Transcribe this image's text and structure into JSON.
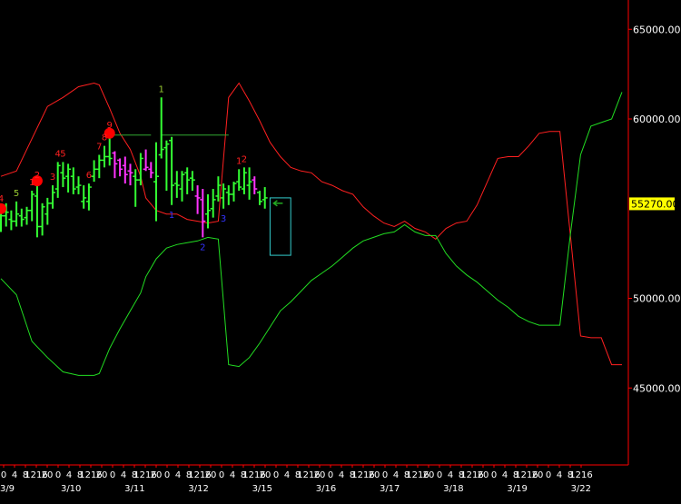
{
  "chart_data": {
    "type": "ohlc",
    "title": "",
    "xlabel": "",
    "ylabel": "",
    "ylim": [
      40000,
      68000
    ],
    "colors": {
      "background": "#000000",
      "axis": "#ff0000",
      "up_bar": "#33ff33",
      "down_bar": "#ff33ff",
      "upper_band": "#ff2020",
      "lower_band": "#22dd22",
      "count_red": "#ff2020",
      "count_green": "#9acd32",
      "count_blue": "#3333ff",
      "marker": "#ff0000",
      "box": "#33cccc",
      "resistance": "#33aa33",
      "price_tag_bg": "#ffff00",
      "arrow": "#22aa22"
    },
    "y_ticks": [
      {
        "value": 65000,
        "label": "65000.00"
      },
      {
        "value": 60000,
        "label": "60000.00"
      },
      {
        "value": 50000,
        "label": "50000.00"
      },
      {
        "value": 45000,
        "label": "45000.00"
      }
    ],
    "current_price": {
      "value": 55270,
      "label": "55270.00"
    },
    "x_time_labels": [
      "0",
      "4",
      "8",
      "1216",
      "20",
      "0",
      "4",
      "8",
      "1216",
      "20",
      "0",
      "4",
      "8",
      "1216",
      "20",
      "0",
      "4",
      "8",
      "1216",
      "20",
      "0",
      "4",
      "8",
      "1216",
      "20",
      "0",
      "4",
      "8",
      "1216",
      "20",
      "0",
      "4",
      "8",
      "1216",
      "20",
      "0",
      "4",
      "8",
      "1216",
      "20",
      "0",
      "4",
      "8",
      "1216",
      "20",
      "0",
      "4",
      "8",
      "1216",
      "20",
      "0",
      "4",
      "8",
      "1216"
    ],
    "x_date_labels": [
      {
        "index": 0,
        "label": "3/9"
      },
      {
        "index": 12,
        "label": "3/10"
      },
      {
        "index": 24,
        "label": "3/11"
      },
      {
        "index": 36,
        "label": "3/12"
      },
      {
        "index": 48,
        "label": "3/15"
      },
      {
        "index": 60,
        "label": "3/16"
      },
      {
        "index": 72,
        "label": "3/17"
      },
      {
        "index": 84,
        "label": "3/18"
      },
      {
        "index": 96,
        "label": "3/19"
      },
      {
        "index": 108,
        "label": "3/22"
      }
    ],
    "bars": [
      {
        "t": 0,
        "o": 54200,
        "h": 55100,
        "l": 53700,
        "c": 54600,
        "color": "up"
      },
      {
        "t": 1,
        "o": 54600,
        "h": 55300,
        "l": 54000,
        "c": 54800,
        "color": "up"
      },
      {
        "t": 2,
        "o": 54400,
        "h": 54900,
        "l": 53800,
        "c": 54300,
        "color": "up"
      },
      {
        "t": 3,
        "o": 54300,
        "h": 55400,
        "l": 54000,
        "c": 54700,
        "color": "up"
      },
      {
        "t": 4,
        "o": 54600,
        "h": 55000,
        "l": 54000,
        "c": 54400,
        "color": "up"
      },
      {
        "t": 5,
        "o": 54500,
        "h": 55100,
        "l": 54100,
        "c": 54900,
        "color": "up"
      },
      {
        "t": 6,
        "o": 54900,
        "h": 56000,
        "l": 54300,
        "c": 55800,
        "color": "up"
      },
      {
        "t": 7,
        "o": 55700,
        "h": 56400,
        "l": 53400,
        "c": 54000,
        "color": "up"
      },
      {
        "t": 8,
        "o": 54000,
        "h": 55300,
        "l": 53500,
        "c": 55100,
        "color": "up"
      },
      {
        "t": 9,
        "o": 54700,
        "h": 55600,
        "l": 54100,
        "c": 55300,
        "color": "up"
      },
      {
        "t": 10,
        "o": 55300,
        "h": 56300,
        "l": 55000,
        "c": 55900,
        "color": "up"
      },
      {
        "t": 11,
        "o": 56100,
        "h": 57600,
        "l": 55600,
        "c": 57400,
        "color": "up"
      },
      {
        "t": 12,
        "o": 57000,
        "h": 57600,
        "l": 56200,
        "c": 56700,
        "color": "up"
      },
      {
        "t": 13,
        "o": 56800,
        "h": 57500,
        "l": 55900,
        "c": 57200,
        "color": "up"
      },
      {
        "t": 14,
        "o": 56800,
        "h": 57300,
        "l": 55800,
        "c": 56100,
        "color": "up"
      },
      {
        "t": 15,
        "o": 56200,
        "h": 56800,
        "l": 55800,
        "c": 56300,
        "color": "up"
      },
      {
        "t": 16,
        "o": 55400,
        "h": 56300,
        "l": 55000,
        "c": 55600,
        "color": "up"
      },
      {
        "t": 17,
        "o": 55400,
        "h": 56400,
        "l": 54900,
        "c": 56200,
        "color": "up"
      },
      {
        "t": 18,
        "o": 56800,
        "h": 57700,
        "l": 56500,
        "c": 57200,
        "color": "up"
      },
      {
        "t": 19,
        "o": 57200,
        "h": 58000,
        "l": 56700,
        "c": 57700,
        "color": "up"
      },
      {
        "t": 20,
        "o": 57700,
        "h": 58500,
        "l": 57300,
        "c": 57900,
        "color": "up"
      },
      {
        "t": 21,
        "o": 57900,
        "h": 59200,
        "l": 57400,
        "c": 57800,
        "color": "up"
      },
      {
        "t": 22,
        "o": 58100,
        "h": 58200,
        "l": 56700,
        "c": 57500,
        "color": "down"
      },
      {
        "t": 23,
        "o": 57700,
        "h": 57800,
        "l": 56800,
        "c": 57200,
        "color": "down"
      },
      {
        "t": 24,
        "o": 57400,
        "h": 57900,
        "l": 56400,
        "c": 56900,
        "color": "down"
      },
      {
        "t": 25,
        "o": 57100,
        "h": 57500,
        "l": 56300,
        "c": 57000,
        "color": "down"
      },
      {
        "t": 26,
        "o": 56800,
        "h": 57200,
        "l": 55100,
        "c": 56600,
        "color": "up"
      },
      {
        "t": 27,
        "o": 56600,
        "h": 58100,
        "l": 56300,
        "c": 57800,
        "color": "up"
      },
      {
        "t": 28,
        "o": 57200,
        "h": 58300,
        "l": 57100,
        "c": 57300,
        "color": "down"
      },
      {
        "t": 29,
        "o": 57200,
        "h": 57600,
        "l": 56700,
        "c": 57000,
        "color": "down"
      },
      {
        "t": 30,
        "o": 56500,
        "h": 58700,
        "l": 54300,
        "c": 56800,
        "color": "up"
      },
      {
        "t": 31,
        "o": 58000,
        "h": 61200,
        "l": 57800,
        "c": 58300,
        "color": "up"
      },
      {
        "t": 32,
        "o": 58400,
        "h": 58800,
        "l": 56000,
        "c": 58600,
        "color": "up"
      },
      {
        "t": 33,
        "o": 58800,
        "h": 59000,
        "l": 55200,
        "c": 56300,
        "color": "up"
      },
      {
        "t": 34,
        "o": 56400,
        "h": 57100,
        "l": 55600,
        "c": 56300,
        "color": "up"
      },
      {
        "t": 35,
        "o": 56100,
        "h": 57100,
        "l": 55400,
        "c": 56900,
        "color": "up"
      },
      {
        "t": 36,
        "o": 57000,
        "h": 57300,
        "l": 55800,
        "c": 56600,
        "color": "up"
      },
      {
        "t": 37,
        "o": 56700,
        "h": 57100,
        "l": 56000,
        "c": 56600,
        "color": "up"
      },
      {
        "t": 38,
        "o": 55700,
        "h": 56300,
        "l": 54700,
        "c": 55600,
        "color": "down"
      },
      {
        "t": 39,
        "o": 55500,
        "h": 56100,
        "l": 53400,
        "c": 54300,
        "color": "down"
      },
      {
        "t": 40,
        "o": 54700,
        "h": 55800,
        "l": 53900,
        "c": 54900,
        "color": "up"
      },
      {
        "t": 41,
        "o": 55000,
        "h": 56100,
        "l": 54500,
        "c": 55500,
        "color": "up"
      },
      {
        "t": 42,
        "o": 55700,
        "h": 56800,
        "l": 55400,
        "c": 56300,
        "color": "up"
      },
      {
        "t": 43,
        "o": 55600,
        "h": 56400,
        "l": 55000,
        "c": 56100,
        "color": "up"
      },
      {
        "t": 44,
        "o": 55900,
        "h": 56300,
        "l": 55200,
        "c": 55800,
        "color": "up"
      },
      {
        "t": 45,
        "o": 55800,
        "h": 56500,
        "l": 55400,
        "c": 56400,
        "color": "up"
      },
      {
        "t": 46,
        "o": 56500,
        "h": 57200,
        "l": 56000,
        "c": 56200,
        "color": "up"
      },
      {
        "t": 47,
        "o": 56100,
        "h": 57300,
        "l": 55800,
        "c": 57000,
        "color": "up"
      },
      {
        "t": 48,
        "o": 56300,
        "h": 57300,
        "l": 55500,
        "c": 56500,
        "color": "up"
      },
      {
        "t": 49,
        "o": 56600,
        "h": 56800,
        "l": 55800,
        "c": 56100,
        "color": "down"
      },
      {
        "t": 50,
        "o": 55900,
        "h": 56000,
        "l": 55200,
        "c": 55400,
        "color": "up"
      },
      {
        "t": 51,
        "o": 55500,
        "h": 56200,
        "l": 55000,
        "c": 55600,
        "color": "up"
      }
    ],
    "upper_band": [
      [
        0,
        56800
      ],
      [
        3,
        57100
      ],
      [
        6,
        58900
      ],
      [
        9,
        60700
      ],
      [
        12,
        61200
      ],
      [
        15,
        61800
      ],
      [
        18,
        62000
      ],
      [
        19,
        61900
      ],
      [
        21,
        60600
      ],
      [
        23,
        59200
      ],
      [
        25,
        58300
      ],
      [
        27,
        56800
      ],
      [
        28,
        55600
      ],
      [
        30,
        54900
      ],
      [
        32,
        54700
      ],
      [
        34,
        54700
      ],
      [
        36,
        54400
      ],
      [
        38,
        54300
      ],
      [
        40,
        54200
      ],
      [
        42,
        54300
      ],
      [
        44,
        61200
      ],
      [
        46,
        62000
      ],
      [
        48,
        61000
      ],
      [
        50,
        59900
      ],
      [
        52,
        58700
      ],
      [
        54,
        57900
      ],
      [
        56,
        57300
      ],
      [
        58,
        57100
      ],
      [
        60,
        57000
      ],
      [
        62,
        56500
      ],
      [
        64,
        56300
      ],
      [
        66,
        56000
      ],
      [
        68,
        55800
      ],
      [
        70,
        55100
      ],
      [
        72,
        54600
      ],
      [
        74,
        54200
      ],
      [
        76,
        54000
      ],
      [
        78,
        54300
      ],
      [
        80,
        53900
      ],
      [
        82,
        53700
      ],
      [
        84,
        53300
      ],
      [
        86,
        53900
      ],
      [
        88,
        54200
      ],
      [
        90,
        54300
      ],
      [
        92,
        55200
      ],
      [
        94,
        56500
      ],
      [
        96,
        57800
      ],
      [
        98,
        57900
      ],
      [
        100,
        57900
      ],
      [
        102,
        58500
      ],
      [
        104,
        59200
      ],
      [
        106,
        59300
      ],
      [
        108,
        59300
      ],
      [
        110,
        53600
      ],
      [
        112,
        47900
      ],
      [
        114,
        47800
      ],
      [
        116,
        47800
      ],
      [
        118,
        46300
      ],
      [
        120,
        46300
      ]
    ],
    "lower_band": [
      [
        0,
        51100
      ],
      [
        3,
        50200
      ],
      [
        6,
        47600
      ],
      [
        9,
        46700
      ],
      [
        12,
        45900
      ],
      [
        15,
        45700
      ],
      [
        18,
        45700
      ],
      [
        19,
        45800
      ],
      [
        21,
        47200
      ],
      [
        23,
        48300
      ],
      [
        25,
        49300
      ],
      [
        27,
        50300
      ],
      [
        28,
        51200
      ],
      [
        30,
        52200
      ],
      [
        32,
        52800
      ],
      [
        34,
        53000
      ],
      [
        36,
        53100
      ],
      [
        38,
        53200
      ],
      [
        40,
        53400
      ],
      [
        42,
        53300
      ],
      [
        44,
        46300
      ],
      [
        46,
        46200
      ],
      [
        48,
        46700
      ],
      [
        50,
        47500
      ],
      [
        52,
        48400
      ],
      [
        54,
        49300
      ],
      [
        56,
        49800
      ],
      [
        58,
        50400
      ],
      [
        60,
        51000
      ],
      [
        62,
        51400
      ],
      [
        64,
        51800
      ],
      [
        66,
        52300
      ],
      [
        68,
        52800
      ],
      [
        70,
        53200
      ],
      [
        72,
        53400
      ],
      [
        74,
        53600
      ],
      [
        76,
        53700
      ],
      [
        78,
        54100
      ],
      [
        80,
        53700
      ],
      [
        82,
        53500
      ],
      [
        84,
        53500
      ],
      [
        86,
        52500
      ],
      [
        88,
        51800
      ],
      [
        90,
        51300
      ],
      [
        92,
        50900
      ],
      [
        94,
        50400
      ],
      [
        96,
        49900
      ],
      [
        98,
        49500
      ],
      [
        100,
        49000
      ],
      [
        102,
        48700
      ],
      [
        104,
        48500
      ],
      [
        106,
        48500
      ],
      [
        108,
        48500
      ],
      [
        110,
        53500
      ],
      [
        112,
        58000
      ],
      [
        114,
        59600
      ],
      [
        116,
        59800
      ],
      [
        118,
        60000
      ],
      [
        120,
        61500
      ]
    ],
    "count_labels": [
      {
        "t": 0,
        "text": "4",
        "pos": "above",
        "color": "red"
      },
      {
        "t": 3,
        "text": "5",
        "pos": "above",
        "color": "green"
      },
      {
        "t": 6,
        "text": "1",
        "pos": "above",
        "color": "red"
      },
      {
        "t": 7,
        "text": "2",
        "pos": "above",
        "color": "red"
      },
      {
        "t": 10,
        "text": "3",
        "pos": "above",
        "color": "red"
      },
      {
        "t": 11,
        "text": "4",
        "pos": "above",
        "color": "red"
      },
      {
        "t": 12,
        "text": "5",
        "pos": "above",
        "color": "red"
      },
      {
        "t": 17,
        "text": "6",
        "pos": "above",
        "color": "red"
      },
      {
        "t": 19,
        "text": "7",
        "pos": "above",
        "color": "red"
      },
      {
        "t": 20,
        "text": "8",
        "pos": "above",
        "color": "red"
      },
      {
        "t": 21,
        "text": "9",
        "pos": "above",
        "color": "red"
      },
      {
        "t": 31,
        "text": "1",
        "pos": "above",
        "color": "green"
      },
      {
        "t": 33,
        "text": "1",
        "pos": "below",
        "color": "blue"
      },
      {
        "t": 39,
        "text": "2",
        "pos": "below",
        "color": "blue"
      },
      {
        "t": 43,
        "text": "3",
        "pos": "below",
        "color": "blue"
      },
      {
        "t": 46,
        "text": "1",
        "pos": "above",
        "color": "red"
      },
      {
        "t": 47,
        "text": "2",
        "pos": "above",
        "color": "red"
      }
    ],
    "markers": [
      {
        "t": 0,
        "v": 55000
      },
      {
        "t": 7,
        "v": 56550
      },
      {
        "t": 21,
        "v": 59200
      }
    ],
    "resistance_lines": [
      {
        "t0": 21,
        "t1": 29,
        "v": 59100
      },
      {
        "t0": 31,
        "t1": 44,
        "v": 59100
      }
    ],
    "box": {
      "t0": 52,
      "t1": 56,
      "v_top": 55600,
      "v_bottom": 52400
    },
    "arrow": {
      "t": 52,
      "v": 55300
    }
  }
}
